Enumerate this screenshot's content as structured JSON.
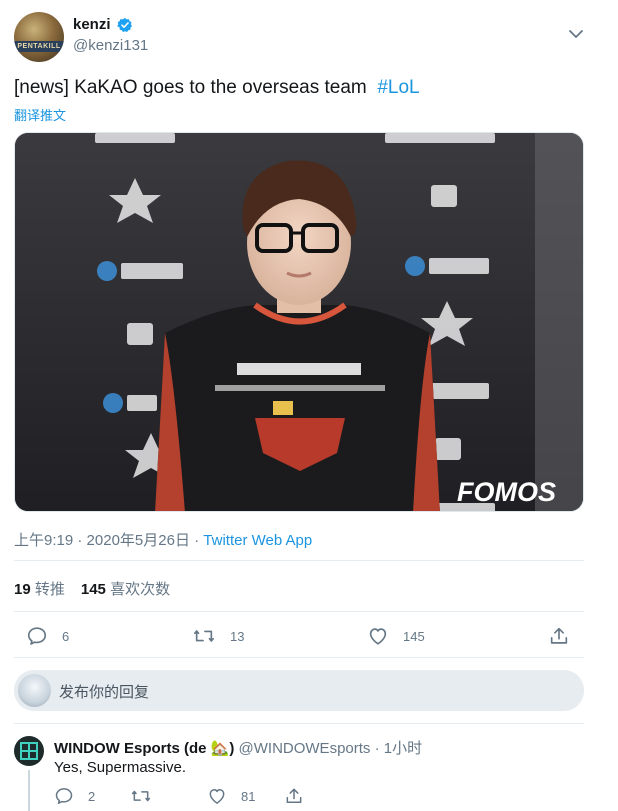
{
  "tweet": {
    "author": {
      "name": "kenzi",
      "handle": "@kenzi131",
      "avatar_banner_text": "PENTAKILL",
      "verified": true
    },
    "text_prefix": "[news] KaKAO goes to the overseas team",
    "hashtag": "#LoL",
    "translate_label": "翻译推文",
    "photo": {
      "watermark": "FOMOS"
    },
    "meta": {
      "time": "上午9:19",
      "separator": "·",
      "date": "2020年5月26日",
      "source": "Twitter Web App"
    },
    "stats": {
      "retweets": "19",
      "retweets_label": "转推",
      "likes": "145",
      "likes_label": "喜欢次数"
    },
    "actions": {
      "replies": "6",
      "retweets": "13",
      "likes": "145"
    }
  },
  "reply_box": {
    "placeholder": "发布你的回复"
  },
  "reply": {
    "name": "WINDOW Esports (de 🏡)",
    "handle": "@WINDOWEsports",
    "separator": "·",
    "time": "1小时",
    "text": "Yes, Supermassive.",
    "actions": {
      "replies": "2",
      "likes": "81"
    }
  },
  "colors": {
    "accent": "#1b95e0",
    "muted": "#657786",
    "divider": "#e6ecf0"
  },
  "icons": [
    "verified-icon",
    "chevron-down-icon",
    "reply-icon",
    "retweet-icon",
    "like-icon",
    "share-icon"
  ]
}
